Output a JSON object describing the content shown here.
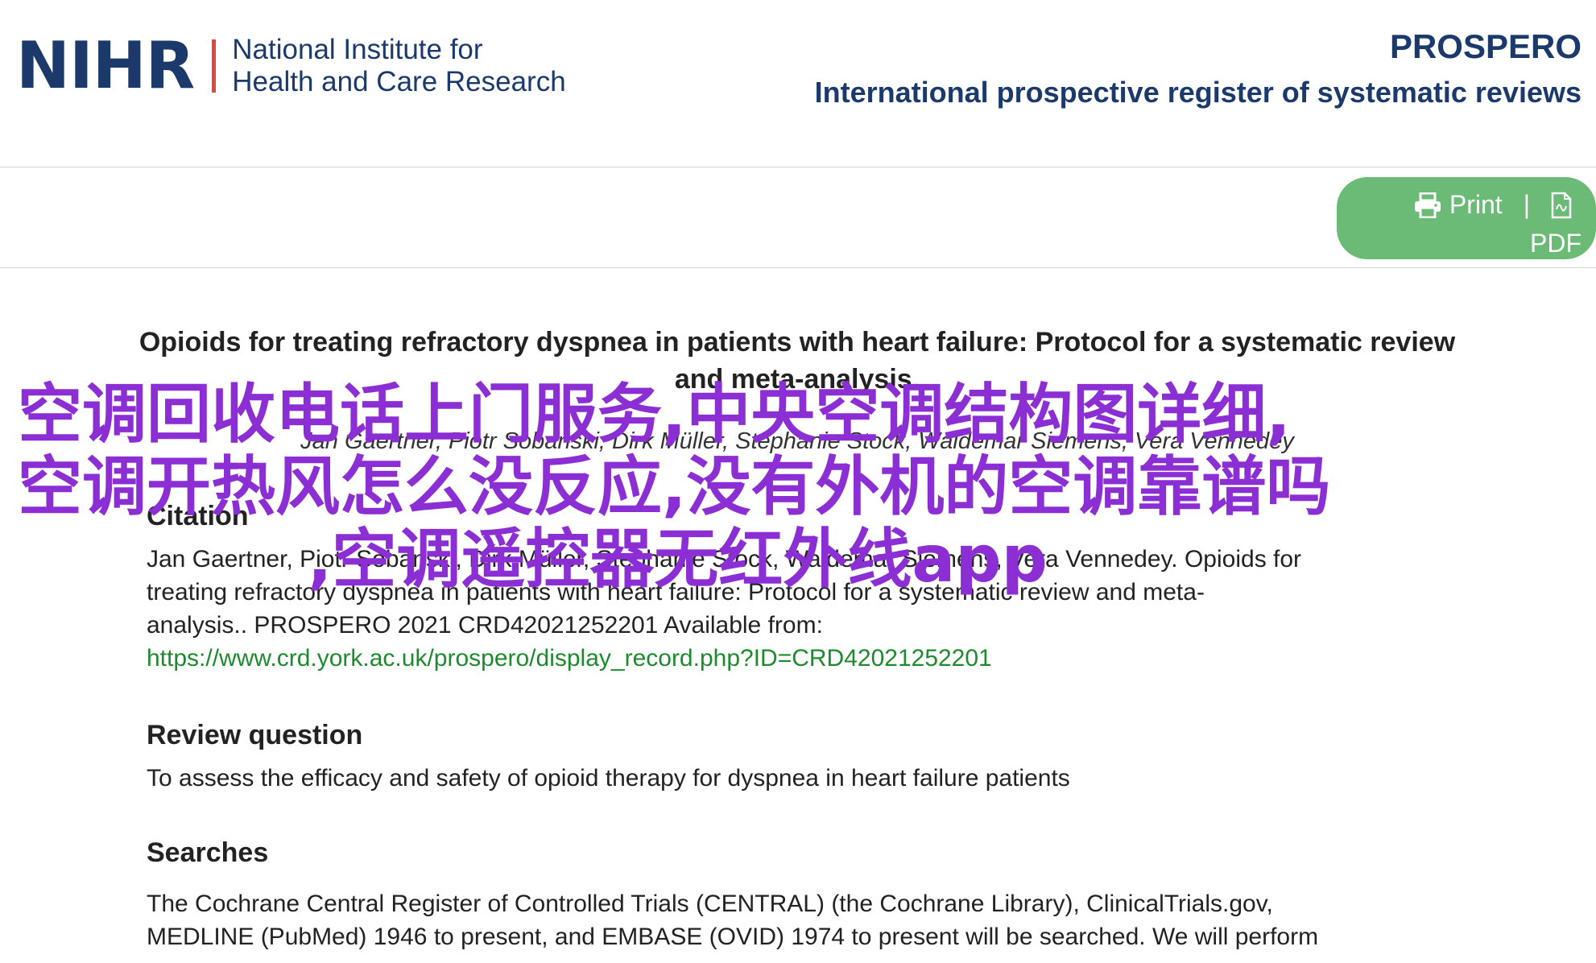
{
  "header": {
    "logo_mark": "NIHR",
    "logo_name_line1": "National Institute for",
    "logo_name_line2": "Health and Care Research",
    "site_title": "PROSPERO",
    "site_subtitle": "International prospective register of systematic reviews"
  },
  "toolbar": {
    "print_label": "Print",
    "separator": "|",
    "pdf_label": "PDF"
  },
  "record": {
    "title": "Opioids for treating refractory dyspnea in patients with heart failure: Protocol for a systematic review and meta-analysis.",
    "authors": "Jan Gaertner, Piotr Sobanski, Dirk Müller, Stephanie Stock, Waldemar Siemens, Vera Vennedey",
    "citation": {
      "heading": "Citation",
      "line1": "Jan Gaertner, Piotr Sobanski, Dirk Müller, Stephanie Stock, Waldemar Siemens, Vera Vennedey. Opioids for",
      "line2": "treating refractory dyspnea in patients with heart failure: Protocol for a systematic review and meta-",
      "line3": "analysis.. PROSPERO 2021 CRD42021252201 Available from:",
      "link": "https://www.crd.york.ac.uk/prospero/display_record.php?ID=CRD42021252201"
    },
    "review_question": {
      "heading": "Review question",
      "text": "To assess the efficacy and safety of opioid therapy for dyspnea in heart failure patients"
    },
    "searches": {
      "heading": "Searches",
      "line1": "The Cochrane Central Register of Controlled Trials (CENTRAL) (the Cochrane Library), ClinicalTrials.gov,",
      "line2": "MEDLINE (PubMed) 1946 to present, and EMBASE (OVID) 1974 to present will be searched. We will perform"
    }
  },
  "overlay": {
    "line1": "空调回收电话上门服务,中央空调结构图详细,",
    "line2": "空调开热风怎么没反应,没有外机的空调靠谱吗",
    "line3": ",空调遥控器无红外线app"
  },
  "colors": {
    "brand_navy": "#1b3a6b",
    "logo_accent": "#e0483a",
    "print_button_green": "#6bbb76",
    "link_green": "#1e8a2e",
    "overlay_purple": "#8b2fd4"
  },
  "icons": {
    "print": "printer-icon",
    "pdf": "pdf-file-icon"
  }
}
